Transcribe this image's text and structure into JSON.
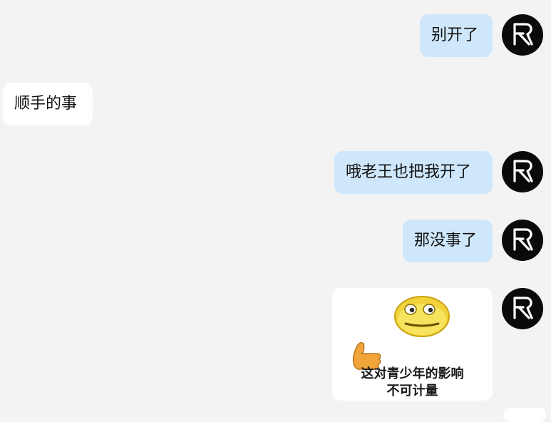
{
  "messages": [
    {
      "from": "me",
      "text": "别开了"
    },
    {
      "from": "other",
      "text": "顺手的事"
    },
    {
      "from": "me",
      "text": "哦老王也把我开了"
    },
    {
      "from": "me",
      "text": "那没事了"
    },
    {
      "from": "me",
      "type": "sticker",
      "caption_line1": "这对青少年的影响",
      "caption_line2": "不可计量"
    }
  ],
  "colors": {
    "background": "#f3f3f3",
    "my_bubble": "#cfe7fb",
    "other_bubble": "#ffffff",
    "avatar_bg": "#0a0a0a",
    "avatar_glyph": "#ffffff"
  },
  "avatar_icon": "fr-monogram-icon"
}
